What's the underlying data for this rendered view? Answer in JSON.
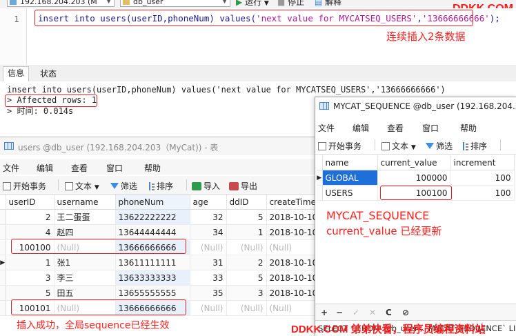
{
  "topbar": {
    "connection": "192.168.204.203 (M",
    "database": "db_user",
    "run_label": "运行",
    "stop_label": "停止",
    "explain_label": "解释",
    "brand": "DDKK.COM"
  },
  "editor": {
    "line_number": "1",
    "sql_prefix": "insert into users(userID,phoneNum) values(",
    "sql_str1": "'next value for MYCATSEQ_USERS'",
    "sql_comma": ",",
    "sql_str2": "'13666666666'",
    "sql_suffix": ");",
    "annotation": "连续插入2条数据"
  },
  "messages": {
    "tabs": [
      "信息",
      "状态"
    ],
    "line1": "insert into users(userID,phoneNum) values('next value for MYCATSEQ_USERS','13666666666')",
    "line2": "> Affected rows: 1",
    "line3": "> 时间: 0.014s"
  },
  "users_window": {
    "title": "users @db_user (192.168.204.203（MyCat)) - 表",
    "menu": [
      "文件",
      "编辑",
      "查看",
      "窗口",
      "帮助"
    ],
    "toolbar": {
      "begin_tx": "开始事务",
      "text": "文本",
      "filter": "筛选",
      "sort": "排序",
      "import": "导入",
      "export": "导出"
    },
    "columns": [
      "userID",
      "username",
      "phoneNum",
      "age",
      "ddID",
      "createTime"
    ],
    "rows": [
      [
        "2",
        "王二蛋蛋",
        "13622222222",
        "32",
        "5",
        "2018-10-10"
      ],
      [
        "4",
        "赵四",
        "13644444444",
        "34",
        "1",
        "2018-10-10"
      ],
      [
        "100100",
        "(Null)",
        "13666666666",
        "(Null)",
        "(Null)",
        "(Null)"
      ],
      [
        "1",
        "张1",
        "13611111111",
        "31",
        "2",
        "2018-10-10"
      ],
      [
        "3",
        "李三",
        "13633333333",
        "33",
        "5",
        "2018-10-10"
      ],
      [
        "5",
        "田五",
        "13655555555",
        "35",
        "3",
        "2018-10-10"
      ],
      [
        "100101",
        "(Null)",
        "13666666666",
        "(Null)",
        "(Null)",
        "(Null)"
      ]
    ],
    "annotation": "插入成功，全局sequence已经生效"
  },
  "sequence_window": {
    "title": "MYCAT_SEQUENCE @db_user (192.168.204.20",
    "menu": [
      "文件",
      "编辑",
      "查看",
      "窗口",
      "帮助"
    ],
    "toolbar": {
      "begin_tx": "开始事务",
      "text": "文本",
      "filter": "筛选",
      "sort": "排序"
    },
    "columns": [
      "name",
      "current_value",
      "increment"
    ],
    "rows": [
      [
        "GLOBAL",
        "100000",
        "100"
      ],
      [
        "USERS",
        "100100",
        "100"
      ]
    ],
    "annotation_line1": "MYCAT_SEQUENCE",
    "annotation_line2": "current_value 已经更新",
    "status_icons": [
      "+",
      "−",
      "✓",
      "✕",
      "C",
      "⊘"
    ],
    "sql": "SELECT * FROM `db_user`.`MYCAT_SEQUENCE` LIM"
  },
  "brand_bottom": "DDKK.COM 弟弟快看，程序员编程资料站",
  "colors": {
    "annotation": "#ff2020",
    "selected_row": "#1e6fd9",
    "keyword": "#1a1a9a",
    "string": "#b0189a"
  }
}
